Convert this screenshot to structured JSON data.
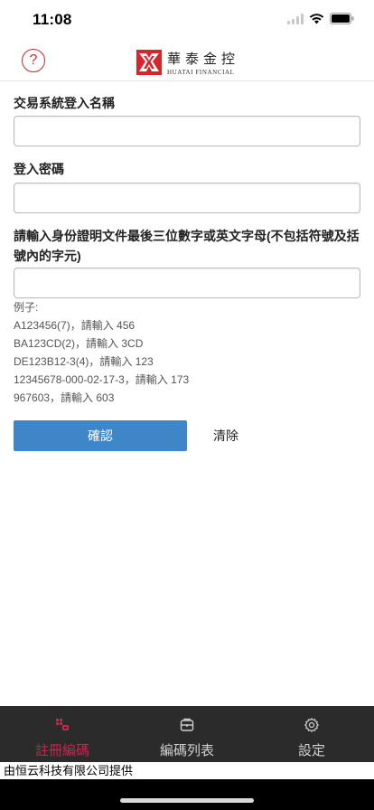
{
  "status_bar": {
    "time": "11:08"
  },
  "header": {
    "help_label": "?",
    "logo_name_cn": "華泰金控",
    "logo_name_en": "HUATAI FINANCIAL",
    "brand_color": "#d7262b"
  },
  "form": {
    "username_label": "交易系統登入名稱",
    "username_value": "",
    "password_label": "登入密碼",
    "password_value": "",
    "id_label": "請輸入身份證明文件最後三位數字或英文字母(不包括符號及括號內的字元)",
    "id_value": ""
  },
  "examples": {
    "heading": "例子:",
    "lines": [
      "A123456(7)，請輸入 456",
      "BA123CD(2)，請輸入 3CD",
      "DE123B12-3(4)，請輸入 123",
      "12345678-000-02-17-3，請輸入 173",
      "967603，請輸入 603"
    ]
  },
  "actions": {
    "confirm_label": "確認",
    "clear_label": "清除",
    "confirm_color": "#3f86c9"
  },
  "tab_bar": {
    "active_color": "#c8254f",
    "tabs": [
      {
        "label": "註冊編碼",
        "icon": "register-code-icon",
        "active": true
      },
      {
        "label": "編碼列表",
        "icon": "code-list-icon",
        "active": false
      },
      {
        "label": "設定",
        "icon": "gear-icon",
        "active": false
      }
    ]
  },
  "footer": {
    "provider_text": "由恒云科技有限公司提供"
  }
}
